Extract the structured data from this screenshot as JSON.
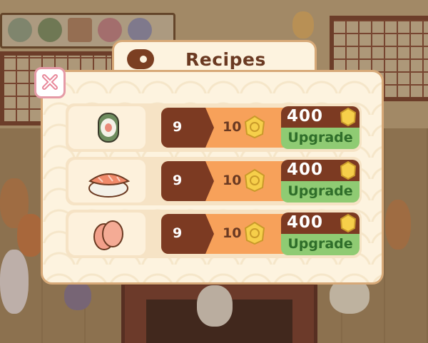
{
  "dialog": {
    "title": "Recipes",
    "icon": "plate-icon",
    "close_icon": "close-icon"
  },
  "recipes": [
    {
      "dish_icon": "maki-roll-icon",
      "level": "9",
      "max_level": "10",
      "cost": "400",
      "button_label": "Upgrade",
      "progress": 0.9
    },
    {
      "dish_icon": "salmon-nigiri-icon",
      "level": "9",
      "max_level": "10",
      "cost": "400",
      "button_label": "Upgrade",
      "progress": 0.9
    },
    {
      "dish_icon": "sashimi-icon",
      "level": "9",
      "max_level": "10",
      "cost": "400",
      "button_label": "Upgrade",
      "progress": 0.9
    }
  ],
  "colors": {
    "panel": "#fdf3df",
    "progress_filled": "#7c3a22",
    "progress_empty": "#f7a15a",
    "upgrade_green": "#8fcb73",
    "coin_gold": "#f6cf4a"
  }
}
